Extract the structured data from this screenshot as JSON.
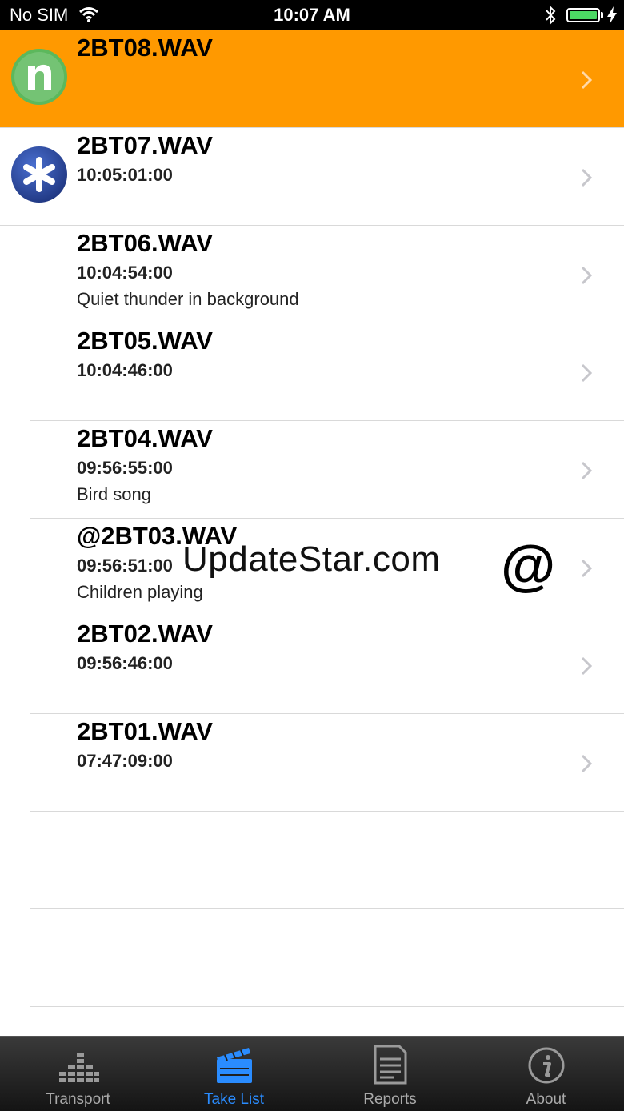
{
  "status_bar": {
    "carrier": "No SIM",
    "time": "10:07 AM",
    "icons": [
      "wifi-icon",
      "bluetooth-icon",
      "battery-icon",
      "charging-icon"
    ]
  },
  "takes": [
    {
      "name": "2BT08.WAV",
      "timecode": "",
      "note": "",
      "selected": true,
      "badge": "n-logo-icon"
    },
    {
      "name": "2BT07.WAV",
      "timecode": "10:05:01:00",
      "note": "",
      "selected": false,
      "badge": "asterisk-badge-icon"
    },
    {
      "name": "2BT06.WAV",
      "timecode": "10:04:54:00",
      "note": "Quiet thunder in background",
      "selected": false
    },
    {
      "name": "2BT05.WAV",
      "timecode": "10:04:46:00",
      "note": "",
      "selected": false
    },
    {
      "name": "2BT04.WAV",
      "timecode": "09:56:55:00",
      "note": "Bird song",
      "selected": false
    },
    {
      "name": "@2BT03.WAV",
      "timecode": "09:56:51:00",
      "note": "Children playing",
      "selected": false
    },
    {
      "name": "2BT02.WAV",
      "timecode": "09:56:46:00",
      "note": "",
      "selected": false
    },
    {
      "name": "2BT01.WAV",
      "timecode": "07:47:09:00",
      "note": "",
      "selected": false
    }
  ],
  "watermark": {
    "text": "UpdateStar.com",
    "symbol": "@"
  },
  "tab_bar": {
    "tabs": [
      {
        "label": "Transport",
        "icon": "transport-meter-icon",
        "active": false
      },
      {
        "label": "Take List",
        "icon": "clapperboard-icon",
        "active": true
      },
      {
        "label": "Reports",
        "icon": "document-icon",
        "active": false
      },
      {
        "label": "About",
        "icon": "info-icon",
        "active": false
      }
    ]
  },
  "colors": {
    "selected_row": "#ff9900",
    "active_tab": "#2a8cff",
    "inactive_tab": "#aaaaaa",
    "battery": "#4cd964",
    "n_logo": "#5cb85c",
    "asterisk_badge": "#2c4a9a"
  }
}
